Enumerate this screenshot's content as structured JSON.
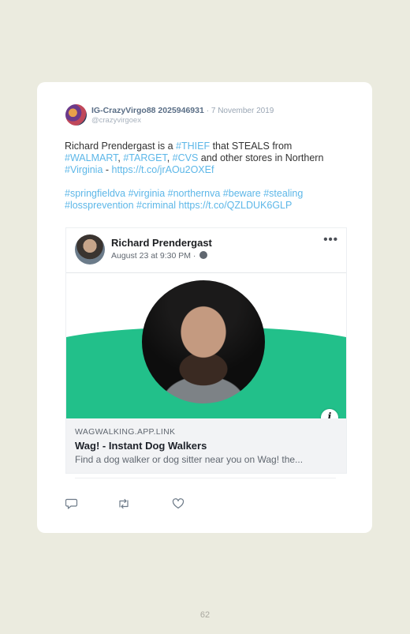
{
  "tweet": {
    "user_name": "IG-CrazyVirgo88 2025946931",
    "date": "· 7 November 2019",
    "handle": "@crazyvirgoex",
    "text_line1_a": "Richard Prendergast is a ",
    "tag_thief": "#THIEF",
    "text_line1_b": " that STEALS from",
    "tag_walmart": "#WALMART",
    "sep1": ", ",
    "tag_target": "#TARGET",
    "sep2": ", ",
    "tag_cvs": "#CVS",
    "text_line2_b": " and other stores in Northern",
    "tag_virginia_cap": "#Virginia",
    "dash": " - ",
    "link1": "https://t.co/jrAOu2OXEf",
    "tags_line": "#springfieldva #virginia #northernva #beware #stealing #lossprevention #criminal",
    "link2": "https://t.co/QZLDUK6GLP"
  },
  "embed": {
    "name": "Richard Prendergast",
    "meta": "August 23 at 9:30 PM · ",
    "more": "•••",
    "info": "i",
    "domain": "WAGWALKING.APP.LINK",
    "title": "Wag! - Instant Dog Walkers",
    "description": "Find a dog walker or dog sitter near you on Wag! the..."
  },
  "page": {
    "number": "62"
  },
  "colors": {
    "link": "#5db7e8",
    "wag_green": "#22c08a",
    "background": "#ebebdf"
  }
}
